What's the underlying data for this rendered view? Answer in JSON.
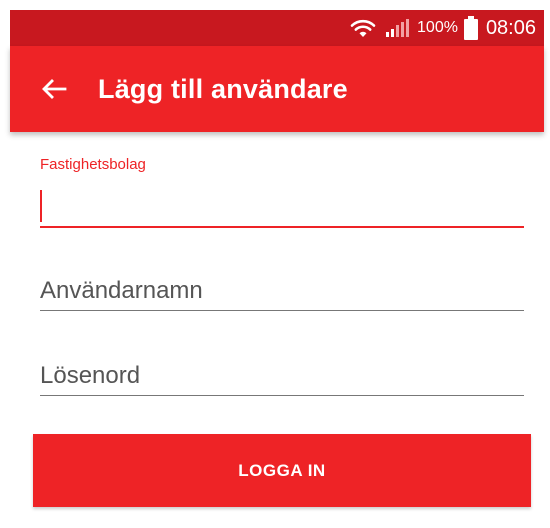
{
  "status_bar": {
    "battery_percent": "100%",
    "time": "08:06",
    "icons": [
      "wifi-icon",
      "signal-icon",
      "battery-icon"
    ]
  },
  "app_bar": {
    "title": "Lägg till användare",
    "back_icon": "arrow-left-icon"
  },
  "form": {
    "company_label": "Fastighetsbolag",
    "company_value": "",
    "username_placeholder": "Användarnamn",
    "username_value": "",
    "password_placeholder": "Lösenord",
    "password_value": ""
  },
  "login_button": {
    "label": "LOGGA IN"
  },
  "colors": {
    "status_bar": "#c8181f",
    "app_bar": "#ee2326",
    "accent": "#ee2326",
    "underline": "#777777"
  }
}
